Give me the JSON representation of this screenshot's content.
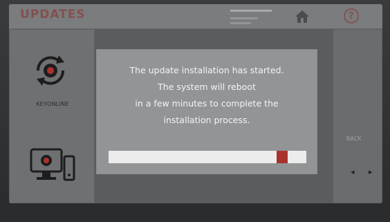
{
  "header": {
    "title": "UPDATES",
    "home_icon": "home-icon",
    "help_icon": "help-icon",
    "help_glyph": "?"
  },
  "sidebar": {
    "keyonline_label": "KEYONLINE",
    "keyonline_icon": "sync-globe-icon",
    "device_icon": "computer-device-icon"
  },
  "right_panel": {
    "back_label": "BACK",
    "prev_glyph": "◂",
    "next_glyph": "▸"
  },
  "dialog": {
    "line1": "The update installation has started.",
    "line2": "The system will reboot",
    "line3": "in a few minutes to complete the",
    "line4": "installation process.",
    "progress": 0.85
  },
  "colors": {
    "accent": "#a9322f",
    "dialog_bg": "#929496",
    "progress_track": "#ececec"
  }
}
